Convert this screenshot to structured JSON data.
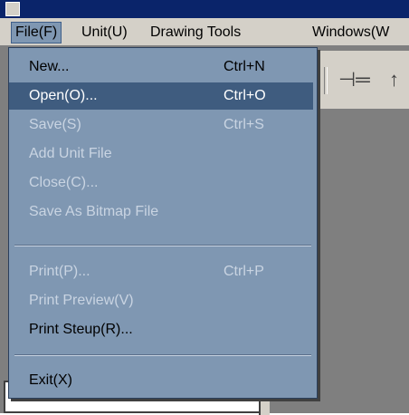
{
  "window": {
    "title": ""
  },
  "menubar": {
    "items": [
      {
        "label": "File(F)"
      },
      {
        "label": "Unit(U)"
      },
      {
        "label": "Drawing Tools"
      },
      {
        "label": "Windows(W"
      }
    ]
  },
  "file_menu": {
    "items": [
      {
        "label": "New...",
        "shortcut": "Ctrl+N",
        "enabled": true
      },
      {
        "label": "Open(O)...",
        "shortcut": "Ctrl+O",
        "enabled": true,
        "highlighted": true
      },
      {
        "label": "Save(S)",
        "shortcut": "Ctrl+S",
        "enabled": false
      },
      {
        "label": "Add Unit File",
        "shortcut": "",
        "enabled": false
      },
      {
        "label": "Close(C)...",
        "shortcut": "",
        "enabled": false
      },
      {
        "label": "Save As Bitmap File",
        "shortcut": "",
        "enabled": false
      },
      {
        "label": "Print(P)...",
        "shortcut": "Ctrl+P",
        "enabled": false
      },
      {
        "label": "Print Preview(V)",
        "shortcut": "",
        "enabled": false
      },
      {
        "label": "Print Steup(R)...",
        "shortcut": "",
        "enabled": true
      },
      {
        "label": "Exit(X)",
        "shortcut": "",
        "enabled": true
      }
    ]
  },
  "toolbar": {
    "icons": [
      "wire-connector-icon",
      "arrow-icon"
    ]
  },
  "colors": {
    "menu_bg": "#7f97b2",
    "highlight_bg": "#3f5c7f",
    "disabled_text": "#c9d4e2",
    "menubar_bg": "#d4d0c8",
    "workspace_bg": "#7f7f7f"
  }
}
